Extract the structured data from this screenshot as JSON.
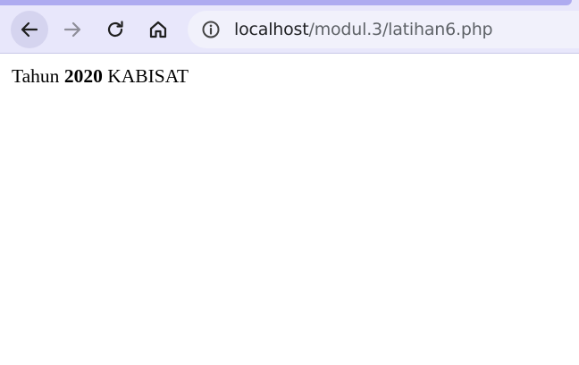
{
  "browser": {
    "url_host": "localhost",
    "url_path": "/modul.3/latihan6.php",
    "icons": {
      "back": "arrow-left-icon",
      "forward": "arrow-right-icon",
      "reload": "reload-icon",
      "home": "home-icon",
      "site_info": "info-icon"
    },
    "colors": {
      "toolbar": "#e8e7fb",
      "tab_strip": "#aeabf0",
      "omnibox": "#f1f1fb"
    }
  },
  "page": {
    "prefix": "Tahun",
    "year": "2020",
    "status": "KABISAT"
  }
}
